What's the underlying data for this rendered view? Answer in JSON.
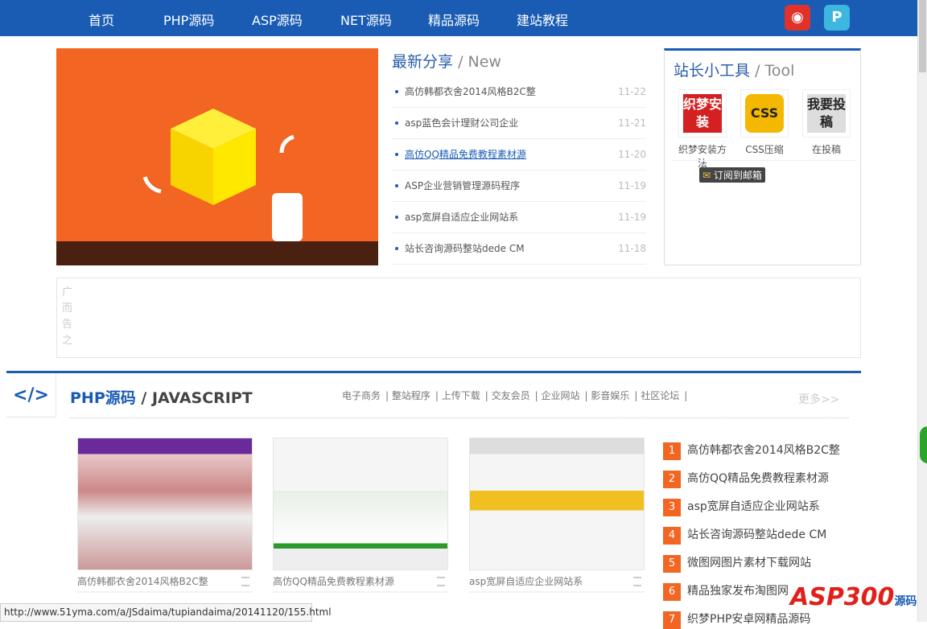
{
  "nav": {
    "items": [
      "首页",
      "PHP源码",
      "ASP源码",
      "NET源码",
      "精品源码",
      "建站教程"
    ],
    "weibo_icon": "weibo-icon",
    "p_icon": "pinterest-like-icon"
  },
  "new": {
    "title": "最新分享",
    "title_en": "/ New",
    "items": [
      {
        "title": "高仿韩都衣舍2014风格B2C整",
        "date": "11-22"
      },
      {
        "title": "asp蓝色会计理财公司企业",
        "date": "11-21"
      },
      {
        "title": "高仿QQ精品免费教程素材源",
        "date": "11-20",
        "hover": true
      },
      {
        "title": "ASP企业营销管理源码程序",
        "date": "11-19"
      },
      {
        "title": "asp宽屏自适应企业网站系",
        "date": "11-19"
      },
      {
        "title": "站长咨询源码整站dede CM",
        "date": "11-18"
      }
    ]
  },
  "tool": {
    "title": "站长小工具",
    "title_en": "/ Tool",
    "items": [
      {
        "label": "织梦安装方法",
        "icon_text": "织梦安装"
      },
      {
        "label": "CSS压缩",
        "icon_text": "CSS"
      },
      {
        "label": "在投稿",
        "icon_text": "我要投稿"
      }
    ],
    "subscribe": "订阅到邮箱"
  },
  "ad": {
    "text": "广而告之"
  },
  "section": {
    "title": "PHP源码",
    "title_en": "/ JAVASCRIPT",
    "tags": [
      "电子商务",
      "整站程序",
      "上传下载",
      "交友会员",
      "企业网站",
      "影音娱乐",
      "社区论坛"
    ],
    "more": "更多>>",
    "thumbs": [
      "高仿韩都衣舍2014风格B2C整",
      "高仿QQ精品免费教程素材源",
      "asp宽屏自适应企业网站系"
    ],
    "ranking": [
      "高仿韩都衣舍2014风格B2C整",
      "高仿QQ精品免费教程素材源",
      "asp宽屏自适应企业网站系",
      "站长咨询源码整站dede CM",
      "微图网图片素材下载网站",
      "精品独家发布淘图网",
      "织梦PHP安卓网精品源码"
    ]
  },
  "status_url": "http://www.51yma.com/a/JSdaima/tupiandaima/20141120/155.html",
  "logo": {
    "text": "ASP300",
    "sub": "源码"
  },
  "colors": {
    "brand": "#1a5cb4",
    "accent": "#f26522"
  }
}
